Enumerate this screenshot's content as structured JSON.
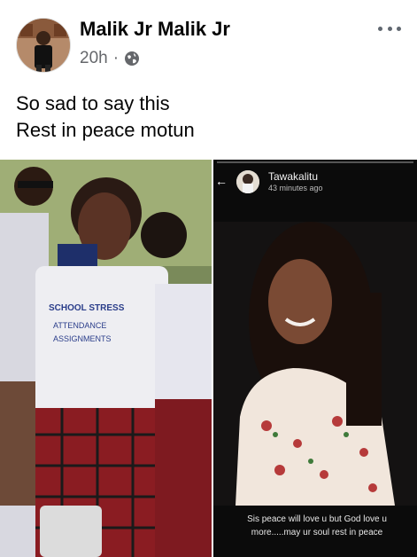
{
  "post": {
    "author": "Malik Jr Malik Jr",
    "time": "20h",
    "separator": "·",
    "text_lines": [
      "So sad to say this",
      "Rest in peace motun"
    ]
  },
  "status": {
    "name": "Tawakalitu",
    "time": "43 minutes ago",
    "caption_lines": [
      "Sis peace will love u but God love u",
      "more.....may ur soul rest in peace"
    ]
  },
  "icons": {
    "privacy": "globe-icon",
    "more": "more-horizontal-icon",
    "back": "back-arrow-icon"
  },
  "colors": {
    "name": "#050505",
    "meta": "#65676b",
    "status_bg": "#0b0b0b"
  }
}
